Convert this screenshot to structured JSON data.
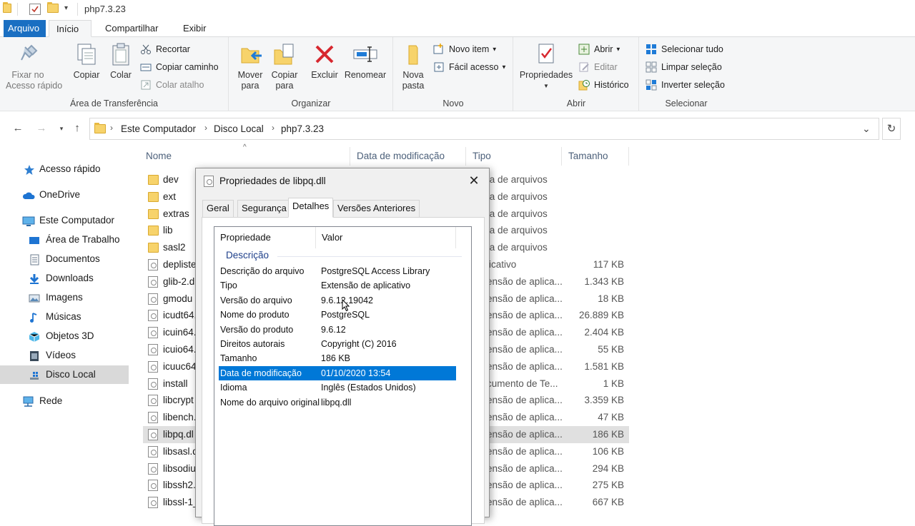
{
  "window": {
    "title": "php7.3.23"
  },
  "ribbon_tabs": [
    "Arquivo",
    "Início",
    "Compartilhar",
    "Exibir"
  ],
  "ribbon": {
    "clipboard": {
      "label": "Área de Transferência",
      "pin": "Fixar no\nAcesso rápido",
      "copy": "Copiar",
      "paste": "Colar",
      "cut": "Recortar",
      "copy_path": "Copiar caminho",
      "paste_shortcut": "Colar atalho"
    },
    "organize": {
      "label": "Organizar",
      "move_to": "Mover\npara",
      "copy_to": "Copiar\npara",
      "delete": "Excluir",
      "rename": "Renomear"
    },
    "new": {
      "label": "Novo",
      "new_folder": "Nova\npasta",
      "new_item": "Novo item",
      "easy_access": "Fácil acesso"
    },
    "open": {
      "label": "Abrir",
      "properties": "Propriedades",
      "open": "Abrir",
      "edit": "Editar",
      "history": "Histórico"
    },
    "select": {
      "label": "Selecionar",
      "select_all": "Selecionar tudo",
      "select_none": "Limpar seleção",
      "invert": "Inverter seleção"
    }
  },
  "breadcrumb": [
    "Este Computador",
    "Disco Local",
    "php7.3.23"
  ],
  "sidebar": [
    {
      "label": "Acesso rápido",
      "icon": "star-icon"
    },
    {
      "label": "OneDrive",
      "icon": "cloud-icon"
    },
    {
      "label": "Este Computador",
      "icon": "computer-icon"
    },
    {
      "label": "Área de Trabalho",
      "icon": "desktop-icon"
    },
    {
      "label": "Documentos",
      "icon": "document-icon"
    },
    {
      "label": "Downloads",
      "icon": "download-icon"
    },
    {
      "label": "Imagens",
      "icon": "image-icon"
    },
    {
      "label": "Músicas",
      "icon": "music-icon"
    },
    {
      "label": "Objetos 3D",
      "icon": "cube-icon"
    },
    {
      "label": "Vídeos",
      "icon": "video-icon"
    },
    {
      "label": "Disco Local",
      "icon": "drive-icon"
    },
    {
      "label": "Rede",
      "icon": "network-icon"
    }
  ],
  "columns": [
    "Nome",
    "Data de modificação",
    "Tipo",
    "Tamanho"
  ],
  "files": [
    {
      "name": "dev",
      "type": "ta de arquivos",
      "size": "",
      "kind": "folder"
    },
    {
      "name": "ext",
      "type": "ta de arquivos",
      "size": "",
      "kind": "folder"
    },
    {
      "name": "extras",
      "type": "ta de arquivos",
      "size": "",
      "kind": "folder"
    },
    {
      "name": "lib",
      "type": "ta de arquivos",
      "size": "",
      "kind": "folder"
    },
    {
      "name": "sasl2",
      "type": "ta de arquivos",
      "size": "",
      "kind": "folder"
    },
    {
      "name": "depliste",
      "type": "licativo",
      "size": "117 KB",
      "kind": "exe"
    },
    {
      "name": "glib-2.d",
      "type": "ensão de aplica...",
      "size": "1.343 KB",
      "kind": "dll"
    },
    {
      "name": "gmodu",
      "type": "ensão de aplica...",
      "size": "18 KB",
      "kind": "dll"
    },
    {
      "name": "icudt64.",
      "type": "ensão de aplica...",
      "size": "26.889 KB",
      "kind": "dll"
    },
    {
      "name": "icuin64.",
      "type": "ensão de aplica...",
      "size": "2.404 KB",
      "kind": "dll"
    },
    {
      "name": "icuio64.",
      "type": "ensão de aplica...",
      "size": "55 KB",
      "kind": "dll"
    },
    {
      "name": "icuuc64",
      "type": "ensão de aplica...",
      "size": "1.581 KB",
      "kind": "dll"
    },
    {
      "name": "install",
      "type": "cumento de Te...",
      "size": "1 KB",
      "kind": "txt"
    },
    {
      "name": "libcrypt",
      "type": "ensão de aplica...",
      "size": "3.359 KB",
      "kind": "dll"
    },
    {
      "name": "libench.",
      "type": "ensão de aplica...",
      "size": "47 KB",
      "kind": "dll"
    },
    {
      "name": "libpq.dl",
      "type": "ensão de aplica...",
      "size": "186 KB",
      "kind": "dll",
      "selected": true
    },
    {
      "name": "libsasl.d",
      "type": "ensão de aplica...",
      "size": "106 KB",
      "kind": "dll"
    },
    {
      "name": "libsodiu",
      "type": "ensão de aplica...",
      "size": "294 KB",
      "kind": "dll"
    },
    {
      "name": "libssh2.",
      "type": "ensão de aplica...",
      "size": "275 KB",
      "kind": "dll"
    },
    {
      "name": "libssl-1_",
      "type": "ensão de aplica...",
      "size": "667 KB",
      "kind": "dll"
    }
  ],
  "dialog": {
    "title": "Propriedades de libpq.dll",
    "tabs": [
      "Geral",
      "Segurança",
      "Detalhes",
      "Versões Anteriores"
    ],
    "active_tab": "Detalhes",
    "col_property": "Propriedade",
    "col_value": "Valor",
    "group": "Descrição",
    "rows": [
      {
        "k": "Descrição do arquivo",
        "v": "PostgreSQL Access Library"
      },
      {
        "k": "Tipo",
        "v": "Extensão de aplicativo"
      },
      {
        "k": "Versão do arquivo",
        "v": "9.6.12.19042"
      },
      {
        "k": "Nome do produto",
        "v": "PostgreSQL"
      },
      {
        "k": "Versão do produto",
        "v": "9.6.12"
      },
      {
        "k": "Direitos autorais",
        "v": "Copyright (C) 2016"
      },
      {
        "k": "Tamanho",
        "v": "186 KB"
      },
      {
        "k": "Data de modificação",
        "v": "01/10/2020 13:54",
        "selected": true
      },
      {
        "k": "Idioma",
        "v": "Inglês (Estados Unidos)"
      },
      {
        "k": "Nome do arquivo original",
        "v": "libpq.dll"
      }
    ]
  },
  "colors": {
    "accent": "#0078d7",
    "file_tab": "#1a6fc2",
    "folder": "#f7d36b"
  }
}
